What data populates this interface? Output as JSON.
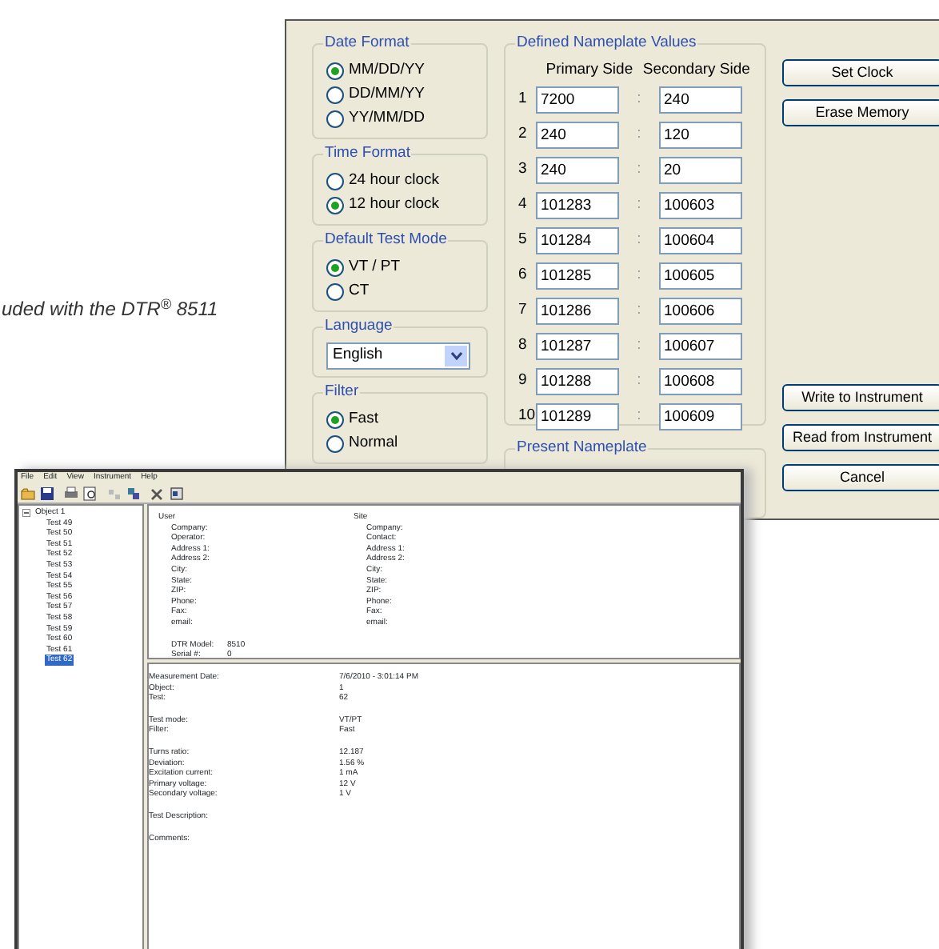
{
  "caption": "uded with the DTR$^{®}$ 8511",
  "dialog": {
    "left_groups": [
      {
        "kind": "radio",
        "title": "Date Format",
        "options": [
          {
            "label": "MM/DD/YY",
            "selected": true
          },
          {
            "label": "DD/MM/YY",
            "selected": false
          },
          {
            "label": "YY/MM/DD",
            "selected": false
          }
        ]
      },
      {
        "kind": "radio",
        "title": "Time Format",
        "options": [
          {
            "label": "24 hour clock",
            "selected": false
          },
          {
            "label": "12 hour clock",
            "selected": true
          }
        ]
      },
      {
        "kind": "radio",
        "title": "Default Test Mode",
        "options": [
          {
            "label": "VT / PT",
            "selected": true
          },
          {
            "label": "CT",
            "selected": false
          }
        ]
      },
      {
        "kind": "select",
        "title": "Language",
        "value": "English"
      },
      {
        "kind": "radio",
        "title": "Filter",
        "options": [
          {
            "label": "Fast",
            "selected": true
          },
          {
            "label": "Normal",
            "selected": false
          }
        ]
      }
    ],
    "nameplate": {
      "title": "Defined Nameplate Values",
      "columns": [
        "Primary Side",
        "Secondary Side"
      ],
      "rows": [
        {
          "index": "1",
          "primary": "7200",
          "separator": ":",
          "secondary": "240"
        },
        {
          "index": "2",
          "primary": "240",
          "separator": ":",
          "secondary": "120"
        },
        {
          "index": "3",
          "primary": "240",
          "separator": ":",
          "secondary": "20"
        },
        {
          "index": "4",
          "primary": "101283",
          "separator": ":",
          "secondary": "100603"
        },
        {
          "index": "5",
          "primary": "101284",
          "separator": ":",
          "secondary": "100604"
        },
        {
          "index": "6",
          "primary": "101285",
          "separator": ":",
          "secondary": "100605"
        },
        {
          "index": "7",
          "primary": "101286",
          "separator": ":",
          "secondary": "100606"
        },
        {
          "index": "8",
          "primary": "101287",
          "separator": ":",
          "secondary": "100607"
        },
        {
          "index": "9",
          "primary": "101288",
          "separator": ":",
          "secondary": "100608"
        },
        {
          "index": "10",
          "primary": "101289",
          "separator": ":",
          "secondary": "100609"
        }
      ]
    },
    "present_nameplate": {
      "title": "Present Nameplate"
    },
    "top_buttons": [
      "Set Clock",
      "Erase Memory"
    ],
    "bottom_buttons": [
      "Write to Instrument",
      "Read from Instrument",
      "Cancel"
    ]
  },
  "main_window": {
    "menu": [
      "File",
      "Edit",
      "View",
      "Instrument",
      "Help"
    ],
    "tree": {
      "label": "Object 1",
      "expanded": true,
      "children": [
        {
          "label": "Test 49",
          "selected": false
        },
        {
          "label": "Test 50",
          "selected": false
        },
        {
          "label": "Test 51",
          "selected": false
        },
        {
          "label": "Test 52",
          "selected": false
        },
        {
          "label": "Test 53",
          "selected": false
        },
        {
          "label": "Test 54",
          "selected": false
        },
        {
          "label": "Test 55",
          "selected": false
        },
        {
          "label": "Test 56",
          "selected": false
        },
        {
          "label": "Test 57",
          "selected": false
        },
        {
          "label": "Test 58",
          "selected": false
        },
        {
          "label": "Test 59",
          "selected": false
        },
        {
          "label": "Test 60",
          "selected": false
        },
        {
          "label": "Test 61",
          "selected": false
        },
        {
          "label": "Test 62",
          "selected": true
        }
      ]
    },
    "user": {
      "title": "User",
      "fields": [
        "Company:",
        "Operator:",
        "Address 1:",
        "Address 2:",
        "City:",
        "State:",
        "ZIP:",
        "Phone:",
        "Fax:",
        "email:"
      ]
    },
    "site": {
      "title": "Site",
      "fields": [
        "Company:",
        "Contact:",
        "Address 1:",
        "Address 2:",
        "City:",
        "State:",
        "ZIP:",
        "Phone:",
        "Fax:",
        "email:"
      ]
    },
    "instrument": [
      {
        "label": "DTR Model:",
        "value": "8510"
      },
      {
        "label": "Serial #:",
        "value": "0"
      }
    ],
    "measurement": [
      [
        {
          "label": "Measurement Date:",
          "value": "7/6/2010 - 3:01:14 PM"
        },
        {
          "label": "Object:",
          "value": "1"
        },
        {
          "label": "Test:",
          "value": "62"
        }
      ],
      [
        {
          "label": "Test mode:",
          "value": "VT/PT"
        },
        {
          "label": "Filter:",
          "value": "Fast"
        }
      ],
      [
        {
          "label": "Turns ratio:",
          "value": "12.187"
        },
        {
          "label": "Deviation:",
          "value": "1.56 %"
        },
        {
          "label": "Excitation current:",
          "value": "1 mA"
        },
        {
          "label": "Primary voltage:",
          "value": "12 V"
        },
        {
          "label": "Secondary voltage:",
          "value": "1 V"
        }
      ],
      [
        {
          "label": "Test Description:"
        }
      ],
      [
        {
          "label": "Comments:"
        }
      ]
    ]
  }
}
